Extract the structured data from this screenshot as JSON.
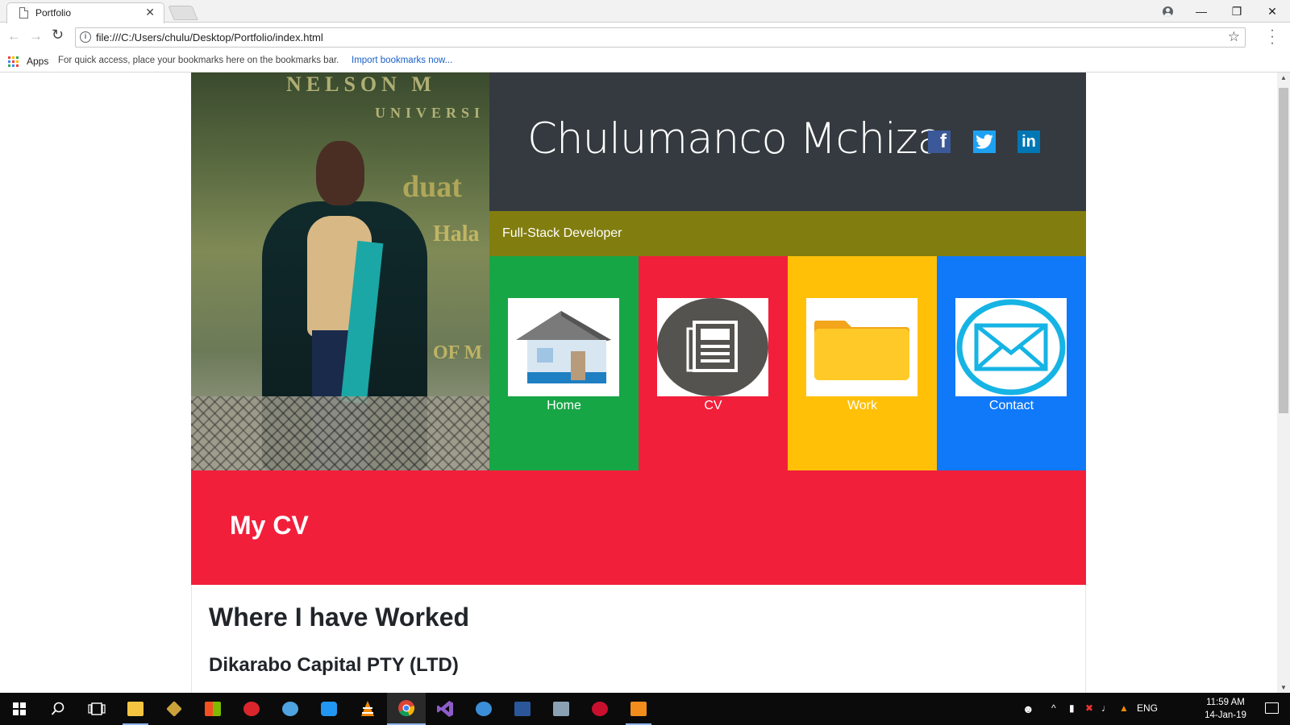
{
  "browser": {
    "tab_title": "Portfolio",
    "tab_close": "✕",
    "url": "file:///C:/Users/chulu/Desktop/Portfolio/index.html",
    "bookmarks_apps": "Apps",
    "bookmarks_hint": "For quick access, place your bookmarks here on the bookmarks bar.",
    "bookmarks_import": "Import bookmarks now..."
  },
  "site": {
    "name": "Chulumanco Mchiza",
    "role": "Full-Stack Developer",
    "social": {
      "facebook": "f",
      "twitter": "twitter-bird",
      "linkedin": "in"
    },
    "tiles": [
      {
        "label": "Home",
        "icon": "house-icon",
        "color": "#17a645"
      },
      {
        "label": "CV",
        "icon": "newspaper-icon",
        "color": "#f21f3b"
      },
      {
        "label": "Work",
        "icon": "folder-icon",
        "color": "#ffc007"
      },
      {
        "label": "Contact",
        "icon": "envelope-icon",
        "color": "#0f79fa"
      }
    ],
    "cv_title": "My CV",
    "section_heading": "Where I have Worked",
    "company": "Dikarabo Capital PTY (LTD)",
    "colors": {
      "header_bg": "#343a40",
      "role_bg": "#827d0f",
      "cv_banner": "#f21f3b"
    }
  },
  "taskbar": {
    "language": "ENG",
    "time": "11:59 AM",
    "date": "14-Jan-19"
  }
}
